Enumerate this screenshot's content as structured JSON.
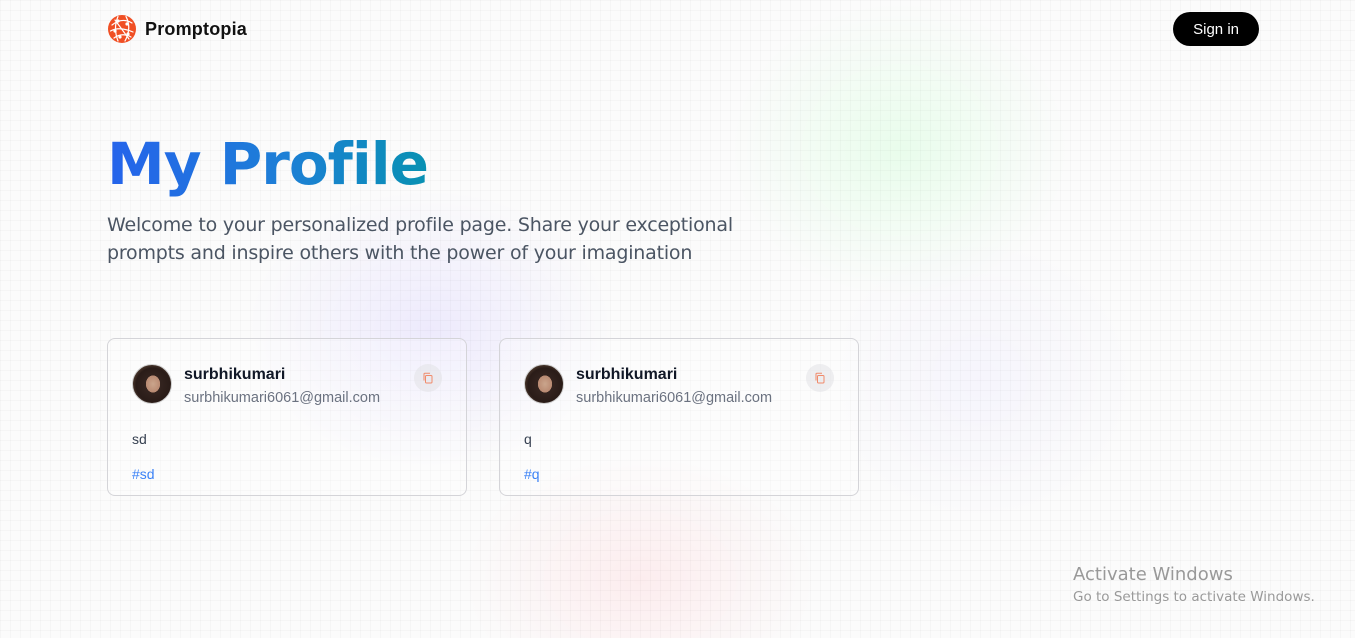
{
  "colors": {
    "title_gradient_start": "#2563eb",
    "title_gradient_end": "#0891b2",
    "tag": "#3b82f6",
    "brand_orange": "#f04f24",
    "button_bg": "#000000"
  },
  "nav": {
    "brand": "Promptopia",
    "logo_icon": "globe-network-icon",
    "signin_label": "Sign in"
  },
  "hero": {
    "title": "My Profile",
    "description": "Welcome to your personalized profile page. Share your exceptional prompts and inspire others with the power of your imagination"
  },
  "posts": [
    {
      "username": "surbhikumari",
      "email": "surbhikumari6061@gmail.com",
      "prompt": "sd",
      "tag": "#sd",
      "copy_icon": "copy-icon"
    },
    {
      "username": "surbhikumari",
      "email": "surbhikumari6061@gmail.com",
      "prompt": "q",
      "tag": "#q",
      "copy_icon": "copy-icon"
    }
  ],
  "watermark": {
    "title": "Activate Windows",
    "subtitle": "Go to Settings to activate Windows."
  }
}
